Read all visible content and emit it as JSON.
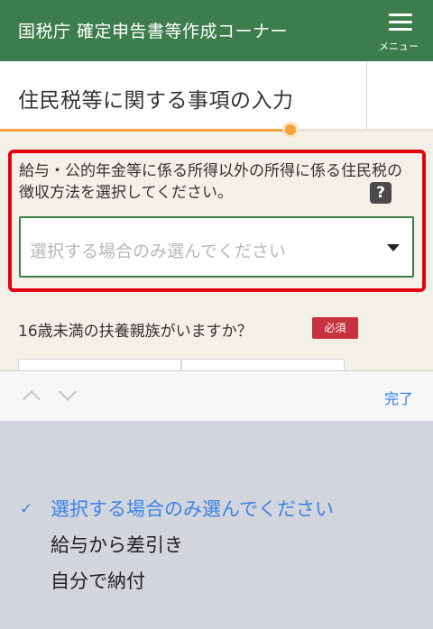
{
  "header": {
    "title": "国税庁 確定申告書等作成コーナー",
    "menu_label": "メニュー",
    "color": "#3d7d4c"
  },
  "page": {
    "title": "住民税等に関する事項の入力",
    "progress": 0.67
  },
  "question1": {
    "text": "給与・公的年金等に係る所得以外の所得に係る住民税の徴収方法を選択してください。",
    "help_label": "?",
    "select_placeholder": "選択する場合のみ選んでください",
    "highlight_color": "#e50012"
  },
  "question2": {
    "text": "16歳未満の扶養親族がいますか？",
    "badge": "必須"
  },
  "picker": {
    "done_label": "完了",
    "check_mark": "✓",
    "options": [
      {
        "label": "選択する場合のみ選んでください",
        "selected": true
      },
      {
        "label": "給与から差引き",
        "selected": false
      },
      {
        "label": "自分で納付",
        "selected": false
      }
    ]
  }
}
